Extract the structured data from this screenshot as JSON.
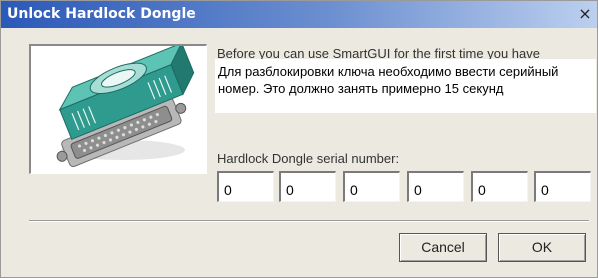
{
  "window": {
    "title": "Unlock Hardlock Dongle",
    "close_symbol": "×"
  },
  "description_original": "Before you can use SmartGUI for the first time you have",
  "description_overlay": "Для разблокировки ключа необходимо ввести серийный номер. Это должно занять примерно 15 секунд",
  "serial": {
    "label": "Hardlock Dongle serial number:",
    "fields": [
      "0",
      "0",
      "0",
      "0",
      "0",
      "0"
    ]
  },
  "buttons": {
    "cancel": "Cancel",
    "ok": "OK"
  },
  "image_icon": "hardlock-dongle-icon"
}
